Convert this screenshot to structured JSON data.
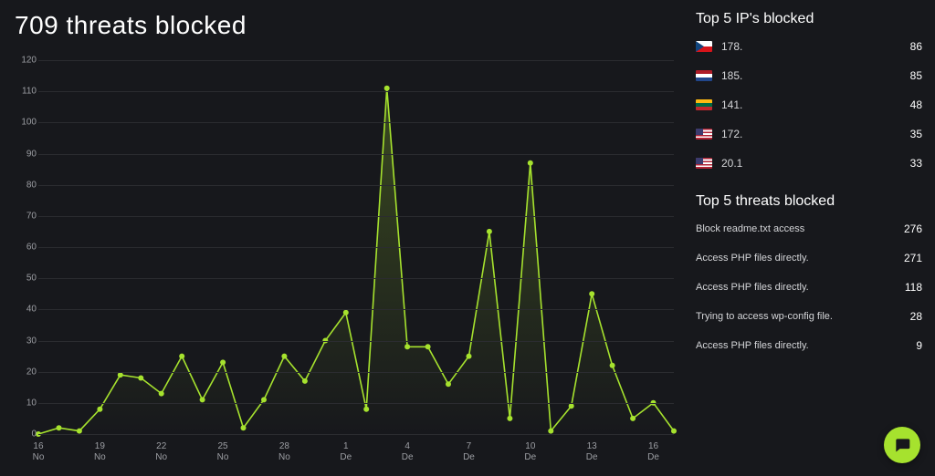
{
  "title": "709 threats blocked",
  "chart_data": {
    "type": "line",
    "title": "709 threats blocked",
    "xlabel": "",
    "ylabel": "",
    "ylim": [
      0,
      120
    ],
    "y_ticks": [
      0,
      10,
      20,
      30,
      40,
      50,
      60,
      70,
      80,
      90,
      100,
      110,
      120
    ],
    "x_ticks": [
      {
        "index": 0,
        "label": "16\nNo"
      },
      {
        "index": 3,
        "label": "19\nNo"
      },
      {
        "index": 6,
        "label": "22\nNo"
      },
      {
        "index": 9,
        "label": "25\nNo"
      },
      {
        "index": 12,
        "label": "28\nNo"
      },
      {
        "index": 15,
        "label": "1\nDe"
      },
      {
        "index": 18,
        "label": "4\nDe"
      },
      {
        "index": 21,
        "label": "7\nDe"
      },
      {
        "index": 24,
        "label": "10\nDe"
      },
      {
        "index": 27,
        "label": "13\nDe"
      },
      {
        "index": 30,
        "label": "16\nDe"
      }
    ],
    "categories": [
      "16 No",
      "17 No",
      "18 No",
      "19 No",
      "20 No",
      "21 No",
      "22 No",
      "23 No",
      "24 No",
      "25 No",
      "26 No",
      "27 No",
      "28 No",
      "29 No",
      "30 No",
      "1 De",
      "2 De",
      "3 De",
      "4 De",
      "5 De",
      "6 De",
      "7 De",
      "8 De",
      "9 De",
      "10 De",
      "11 De",
      "12 De",
      "13 De",
      "14 De",
      "15 De",
      "16 De"
    ],
    "values": [
      0,
      2,
      1,
      8,
      19,
      18,
      13,
      25,
      11,
      23,
      2,
      11,
      25,
      17,
      30,
      39,
      8,
      111,
      28,
      28,
      16,
      25,
      65,
      5,
      87,
      1,
      9,
      45,
      22,
      5,
      10,
      1
    ],
    "color": "#a6e22e"
  },
  "top_ips_title": "Top 5 IP's blocked",
  "top_ips": [
    {
      "flag": "cz",
      "ip": "178.",
      "count": "86"
    },
    {
      "flag": "nl",
      "ip": "185.",
      "count": "85"
    },
    {
      "flag": "lt",
      "ip": "141.",
      "count": "48"
    },
    {
      "flag": "us",
      "ip": "172.",
      "count": "35"
    },
    {
      "flag": "us",
      "ip": "20.1",
      "count": "33"
    }
  ],
  "top_threats_title": "Top 5 threats blocked",
  "top_threats": [
    {
      "name": "Block readme.txt access",
      "count": "276"
    },
    {
      "name": "Access PHP files directly.",
      "count": "271"
    },
    {
      "name": "Access PHP files directly.",
      "count": "118"
    },
    {
      "name": "Trying to access wp-config file.",
      "count": "28"
    },
    {
      "name": "Access PHP files directly.",
      "count": "9"
    }
  ]
}
